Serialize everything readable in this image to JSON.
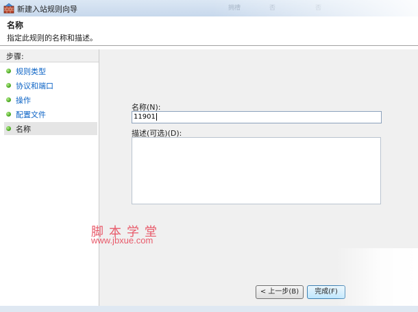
{
  "window": {
    "title": "新建入站规则向导",
    "icon": "firewall-icon",
    "background_ghost_text": [
      "拥槽",
      "否",
      "否"
    ]
  },
  "header": {
    "title": "名称",
    "description": "指定此规则的名称和描述。"
  },
  "steps": {
    "heading": "步骤:",
    "items": [
      {
        "label": "规则类型",
        "active": false
      },
      {
        "label": "协议和端口",
        "active": false
      },
      {
        "label": "操作",
        "active": false
      },
      {
        "label": "配置文件",
        "active": false
      },
      {
        "label": "名称",
        "active": true
      }
    ]
  },
  "form": {
    "name_label": "名称(N):",
    "name_value": "11901",
    "description_label": "描述(可选)(D):",
    "description_value": ""
  },
  "buttons": {
    "back": "< 上一步(B)",
    "finish": "完成(F)"
  },
  "watermark": {
    "chinese": "脚本学堂",
    "url": "www.jbxue.com"
  },
  "colors": {
    "link_blue": "#0a62c5",
    "step_dot_green": "#3fa017",
    "watermark_red": "#e85a6a",
    "main_background": "#f0f0f0"
  }
}
